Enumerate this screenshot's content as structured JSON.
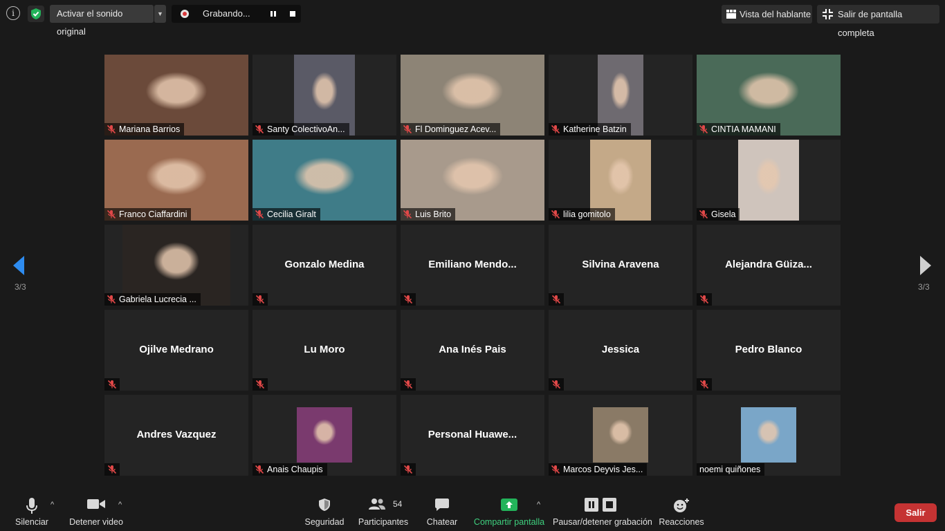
{
  "topbar": {
    "info_icon": "info-icon",
    "security_icon": "shield-check-icon",
    "original_sound_label": "Activar el sonido original",
    "recording_label": "Grabando...",
    "speaker_view_label": "Vista del hablante",
    "exit_fullscreen_label": "Salir de pantalla completa"
  },
  "pagination": {
    "left": "3/3",
    "right": "3/3"
  },
  "participants": [
    {
      "name": "Mariana Barrios",
      "video": true,
      "bg": "#6b4a3a"
    },
    {
      "name": "Santy ColectivoAn...",
      "video": true,
      "bg": "#5a5a66"
    },
    {
      "name": "Fl Dominguez Acev...",
      "video": true,
      "bg": "#8d8476"
    },
    {
      "name": "Katherine Batzin",
      "video": true,
      "bg": "#6e6a70"
    },
    {
      "name": "CINTIA MAMANI",
      "video": true,
      "bg": "#4a6a58"
    },
    {
      "name": "Franco Ciaffardini",
      "video": true,
      "bg": "#9a6a50"
    },
    {
      "name": "Cecilia Giralt",
      "video": true,
      "bg": "#3f7c88"
    },
    {
      "name": "Luis Brito",
      "video": true,
      "bg": "#a89a8c"
    },
    {
      "name": "lilia gomitolo",
      "video": true,
      "bg": "#c4a988"
    },
    {
      "name": "Gisela",
      "video": true,
      "bg": "#cfc4bc"
    },
    {
      "name": "Gabriela Lucrecia ...",
      "video": true,
      "bg": "#2a2522"
    },
    {
      "name": "Gonzalo Medina",
      "video": false
    },
    {
      "name": "Emiliano  Mendo...",
      "video": false
    },
    {
      "name": "Silvina Aravena",
      "video": false
    },
    {
      "name": "Alejandra  Güiza...",
      "video": false
    },
    {
      "name": "Ojilve Medrano",
      "video": false
    },
    {
      "name": "Lu Moro",
      "video": false
    },
    {
      "name": "Ana Inés Pais",
      "video": false
    },
    {
      "name": "Jessica",
      "video": false
    },
    {
      "name": "Pedro Blanco",
      "video": false
    },
    {
      "name": "Andres Vazquez",
      "video": false
    },
    {
      "name": "Anais Chaupis",
      "video": true,
      "photo": true,
      "bg": "#7a3a6e"
    },
    {
      "name": "Personal  Huawe...",
      "video": false
    },
    {
      "name": "Marcos Deyvis Jes...",
      "video": true,
      "photo": true,
      "bg": "#8a7a66"
    },
    {
      "name": "noemi quiñones",
      "video": true,
      "photo": true,
      "bg": "#7aa6c8"
    }
  ],
  "toolbar": {
    "mute_label": "Silenciar",
    "video_label": "Detener video",
    "security_label": "Seguridad",
    "participants_label": "Participantes",
    "participants_count": "54",
    "chat_label": "Chatear",
    "share_label": "Compartir pantalla",
    "recording_label": "Pausar/detener grabación",
    "reactions_label": "Reacciones",
    "leave_label": "Salir"
  },
  "colors": {
    "share_green": "#3fd17f",
    "leave_red": "#c53333",
    "mute_red": "#e04848"
  }
}
